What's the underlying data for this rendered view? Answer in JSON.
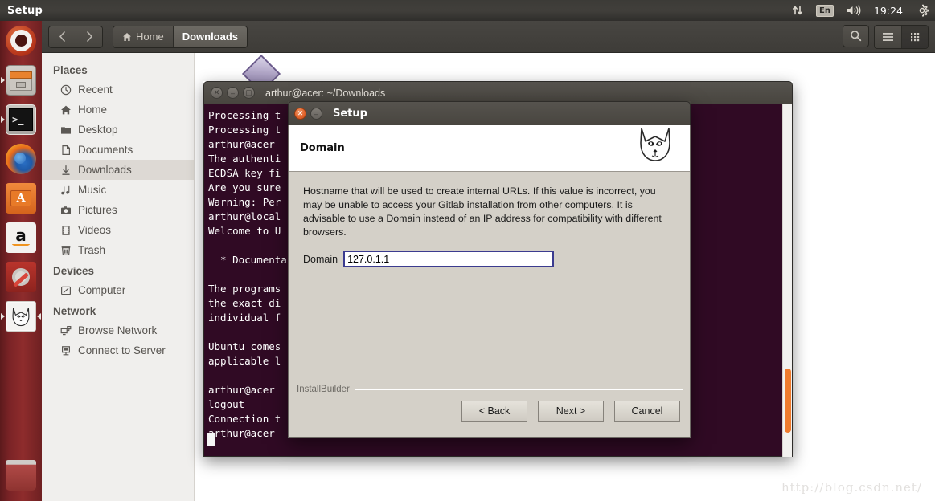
{
  "top_panel": {
    "title": "Setup",
    "indicators": {
      "network": "network-updown-icon",
      "language": "En",
      "volume": "volume-icon",
      "clock": "19:24",
      "system": "gear-icon"
    }
  },
  "launcher": {
    "items": [
      {
        "name": "ubuntu-dash",
        "label": "Dash Home",
        "running": false
      },
      {
        "name": "files",
        "label": "Files",
        "running": true
      },
      {
        "name": "terminal",
        "label": "Terminal",
        "running": true
      },
      {
        "name": "firefox",
        "label": "Firefox Web Browser",
        "running": false
      },
      {
        "name": "software-center",
        "label": "Ubuntu Software Center",
        "running": false
      },
      {
        "name": "amazon",
        "label": "Amazon",
        "running": false
      },
      {
        "name": "system-settings",
        "label": "System Settings",
        "running": false
      },
      {
        "name": "setup-installer",
        "label": "Setup",
        "running": true
      },
      {
        "name": "trash",
        "label": "Trash",
        "running": false
      }
    ]
  },
  "file_manager": {
    "back_label": "‹",
    "forward_label": "›",
    "breadcrumbs": [
      {
        "label": "Home",
        "icon": "home-icon",
        "active": false
      },
      {
        "label": "Downloads",
        "icon": "",
        "active": true
      }
    ],
    "toolbar": {
      "search_label": "search-icon",
      "menu_label": "hamburger-menu-icon",
      "view_label": "grid-view-icon"
    },
    "sidebar": [
      {
        "type": "heading",
        "label": "Places"
      },
      {
        "type": "item",
        "label": "Recent",
        "icon": "clock-icon",
        "active": false
      },
      {
        "type": "item",
        "label": "Home",
        "icon": "home-icon",
        "active": false
      },
      {
        "type": "item",
        "label": "Desktop",
        "icon": "folder-icon",
        "active": false
      },
      {
        "type": "item",
        "label": "Documents",
        "icon": "document-icon",
        "active": false
      },
      {
        "type": "item",
        "label": "Downloads",
        "icon": "download-icon",
        "active": true
      },
      {
        "type": "item",
        "label": "Music",
        "icon": "music-icon",
        "active": false
      },
      {
        "type": "item",
        "label": "Pictures",
        "icon": "camera-icon",
        "active": false
      },
      {
        "type": "item",
        "label": "Videos",
        "icon": "film-icon",
        "active": false
      },
      {
        "type": "item",
        "label": "Trash",
        "icon": "trash-icon",
        "active": false
      },
      {
        "type": "heading",
        "label": "Devices"
      },
      {
        "type": "item",
        "label": "Computer",
        "icon": "computer-icon",
        "active": false
      },
      {
        "type": "heading",
        "label": "Network"
      },
      {
        "type": "item",
        "label": "Browse Network",
        "icon": "network-icon",
        "active": false
      },
      {
        "type": "item",
        "label": "Connect to Server",
        "icon": "server-icon",
        "active": false
      }
    ]
  },
  "terminal": {
    "title": "arthur@acer: ~/Downloads",
    "window_buttons": [
      "close-icon",
      "minimize-icon",
      "maximize-icon"
    ],
    "lines": [
      "Processing t                                                        ",
      "Processing t                                                        ",
      "arthur@acer                                                         ",
      "The authenti                                                    ed. ",
      "ECDSA key fi                                                    c4:29.",
      "Are you sure                                                        ",
      "Warning: Per                                                      hosts.",
      "arthur@local                                                        ",
      "Welcome to U                                                        ",
      "",
      "  * Documenta                                                       ",
      "",
      "The programs                                                        ",
      "the exact di                                                        ",
      "individual f                                                        ",
      "",
      "Ubuntu comes                                                        ",
      "applicable l                                                      y ",
      "",
      "arthur@acer                                                         ",
      "logout                                                              ",
      "Connection t                                                        ",
      "arthur@acer                                                  staller.run"
    ],
    "background_color": "#300a24",
    "text_color": "#ffffff",
    "scrollbar_color": "#f07b2e"
  },
  "setup_dialog": {
    "title": "Setup",
    "window_buttons": [
      "close-icon",
      "minimize-icon"
    ],
    "header": "Domain",
    "logo": "wolf-head-icon",
    "description": "Hostname that will be used to create internal URLs. If this value is incorrect, you may be unable to access your Gitlab installation from other computers. It is advisable to use a Domain instead of an IP address for compatibility with different browsers.",
    "field": {
      "label": "Domain",
      "value": "127.0.1.1",
      "placeholder": "",
      "border_color": "#3b3b8f"
    },
    "footer_brand": "InstallBuilder",
    "buttons": [
      {
        "name": "back-button",
        "label": "< Back"
      },
      {
        "name": "next-button",
        "label": "Next >"
      },
      {
        "name": "cancel-button",
        "label": "Cancel"
      }
    ]
  },
  "watermark": "http://blog.csdn.net/"
}
